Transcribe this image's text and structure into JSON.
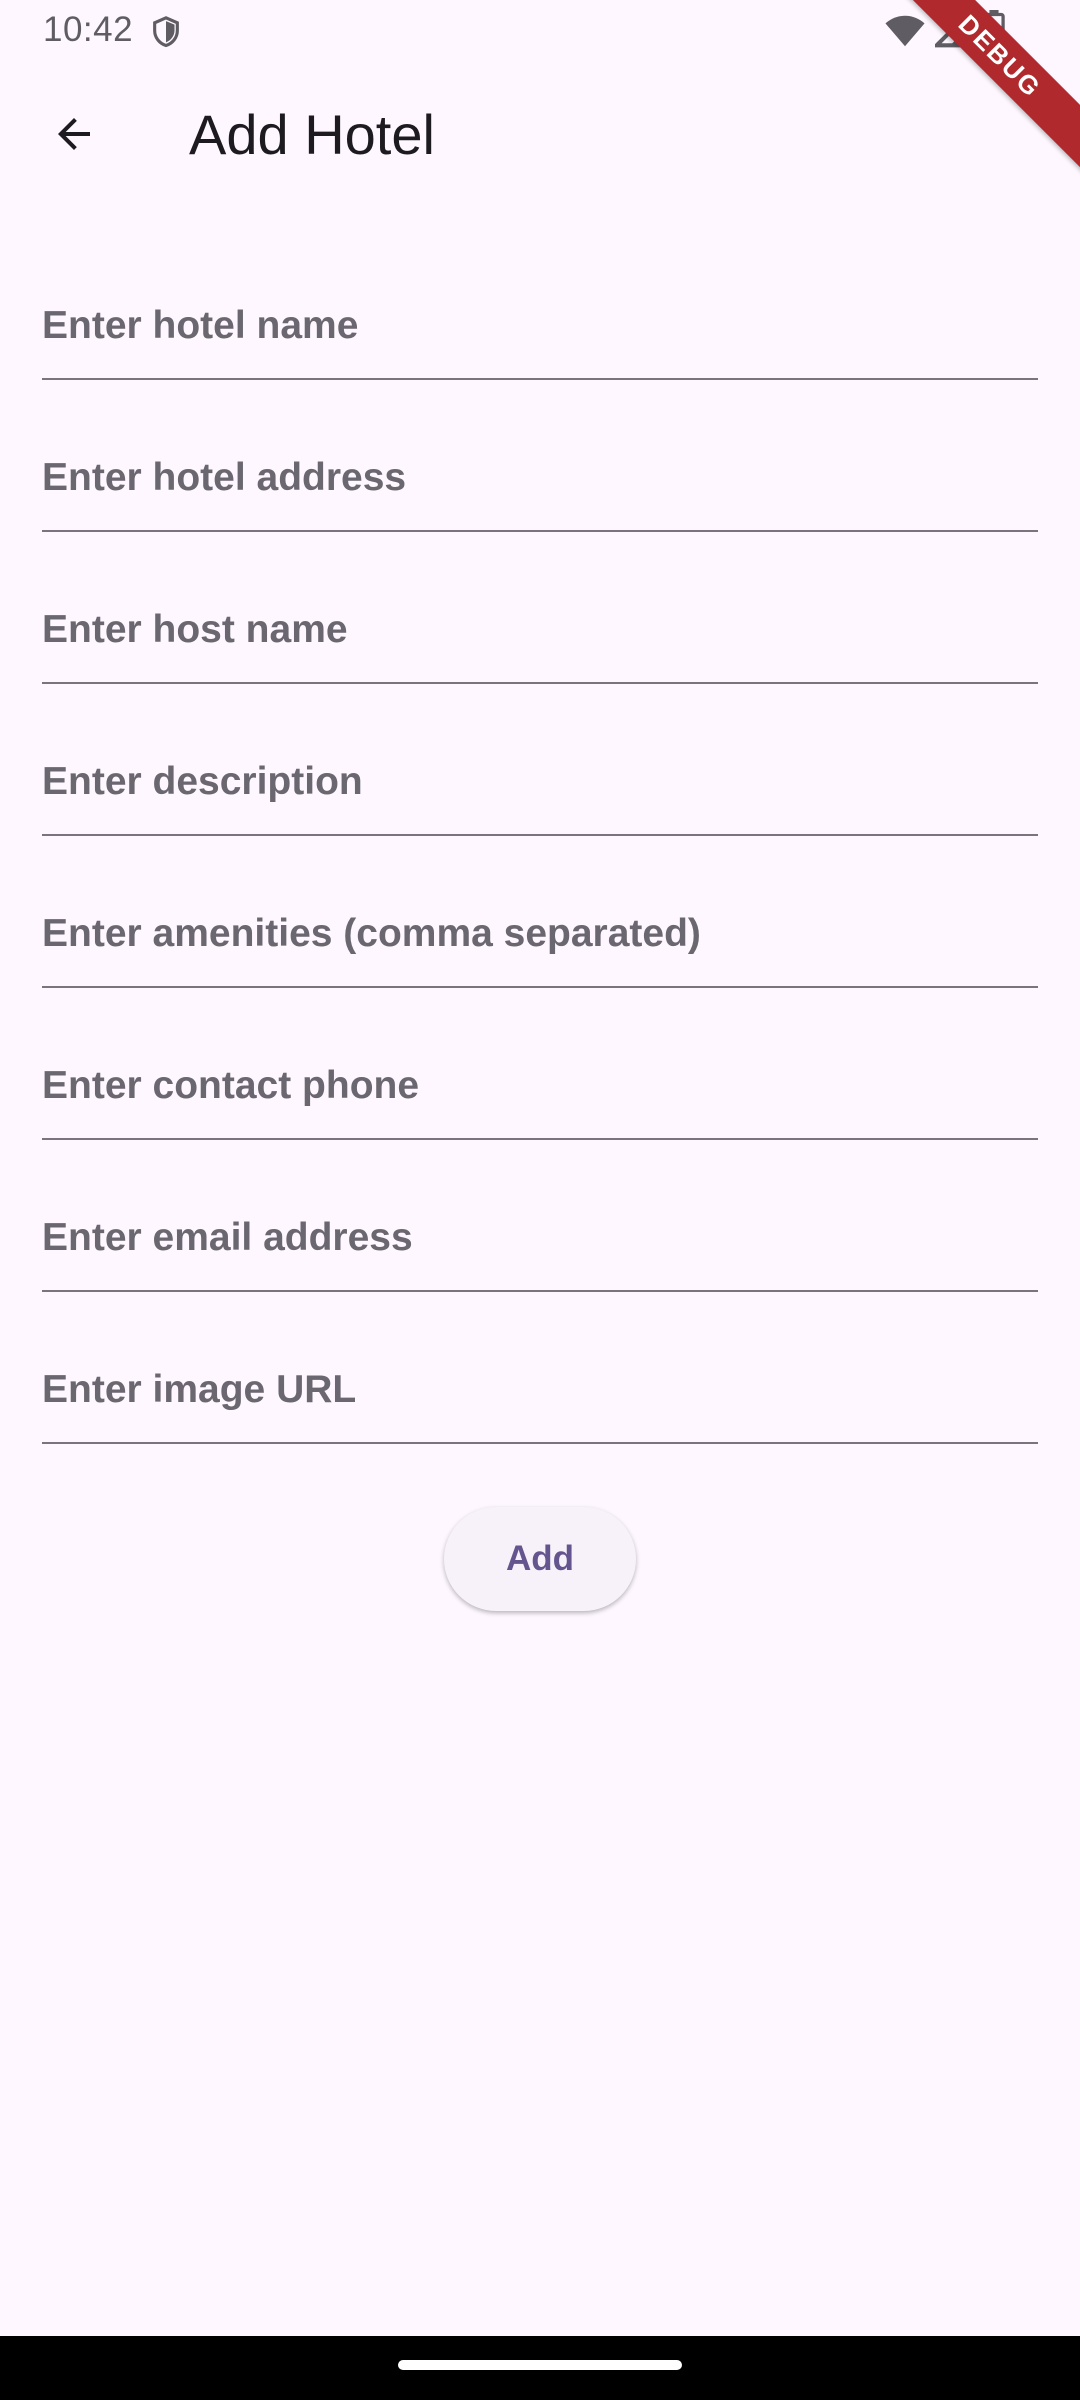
{
  "status_bar": {
    "time": "10:42",
    "icons": [
      "shield-icon",
      "wifi-icon",
      "signal-icon",
      "battery-icon"
    ]
  },
  "debug_banner": "DEBUG",
  "app_bar": {
    "back_icon": "arrow-back-icon",
    "title": "Add Hotel"
  },
  "form": {
    "fields": [
      {
        "name": "hotel-name",
        "placeholder": "Enter hotel name",
        "value": ""
      },
      {
        "name": "hotel-address",
        "placeholder": "Enter hotel address",
        "value": ""
      },
      {
        "name": "host-name",
        "placeholder": "Enter host name",
        "value": ""
      },
      {
        "name": "description",
        "placeholder": "Enter description",
        "value": ""
      },
      {
        "name": "amenities",
        "placeholder": "Enter amenities (comma separated)",
        "value": ""
      },
      {
        "name": "contact-phone",
        "placeholder": "Enter contact phone",
        "value": ""
      },
      {
        "name": "email-address",
        "placeholder": "Enter email address",
        "value": ""
      },
      {
        "name": "image-url",
        "placeholder": "Enter image URL",
        "value": ""
      }
    ],
    "submit_label": "Add"
  },
  "colors": {
    "background": "#FEF7FF",
    "primary": "#65558F",
    "outline": "#79747E",
    "debug_ribbon": "#B0292C"
  }
}
